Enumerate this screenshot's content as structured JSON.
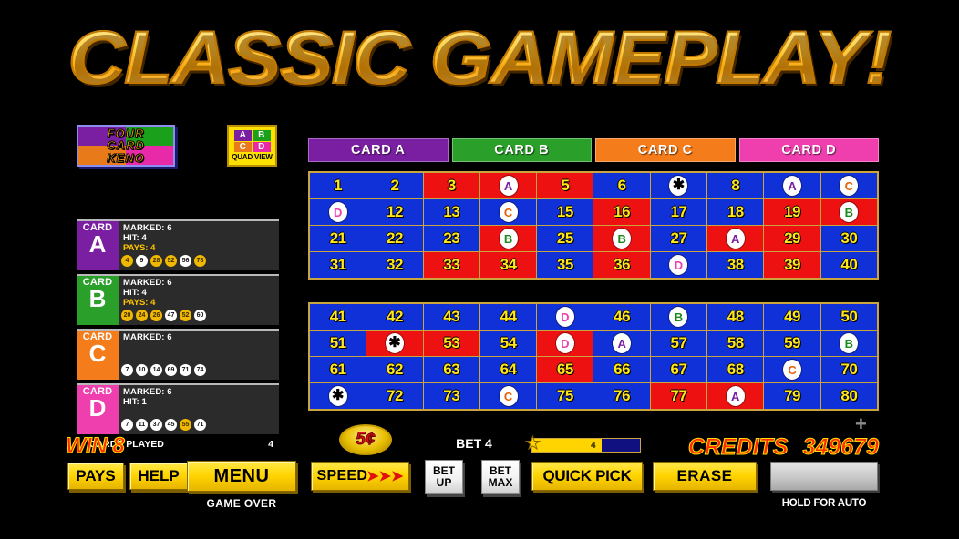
{
  "title": {
    "text": "CLASSIC GAMEPLAY!"
  },
  "logo": {
    "line1": "FOUR",
    "line2": "CARD",
    "line3": "KENO",
    "quad_view": {
      "label": "QUAD VIEW",
      "cells": [
        "A",
        "B",
        "C",
        "D"
      ]
    }
  },
  "cards": [
    {
      "word": "CARD",
      "letter": "A",
      "color": "#7a1fa2",
      "marked_label": "MARKED: 6",
      "hit_label": "HIT: 4",
      "pays_label": "PAYS: 4",
      "balls": [
        {
          "n": "4",
          "hit": true
        },
        {
          "n": "9",
          "hit": false
        },
        {
          "n": "28",
          "hit": true
        },
        {
          "n": "52",
          "hit": true
        },
        {
          "n": "56",
          "hit": false
        },
        {
          "n": "78",
          "hit": true
        }
      ]
    },
    {
      "word": "CARD",
      "letter": "B",
      "color": "#2aa02a",
      "marked_label": "MARKED: 6",
      "hit_label": "HIT: 4",
      "pays_label": "PAYS: 4",
      "balls": [
        {
          "n": "20",
          "hit": true
        },
        {
          "n": "24",
          "hit": true
        },
        {
          "n": "26",
          "hit": true
        },
        {
          "n": "47",
          "hit": false
        },
        {
          "n": "52",
          "hit": true
        },
        {
          "n": "60",
          "hit": false
        }
      ]
    },
    {
      "word": "CARD",
      "letter": "C",
      "color": "#f57c1a",
      "marked_label": "MARKED: 6",
      "hit_label": "",
      "pays_label": "",
      "balls": [
        {
          "n": "7",
          "hit": false
        },
        {
          "n": "10",
          "hit": false
        },
        {
          "n": "14",
          "hit": false
        },
        {
          "n": "69",
          "hit": false
        },
        {
          "n": "71",
          "hit": false
        },
        {
          "n": "74",
          "hit": false
        }
      ]
    },
    {
      "word": "CARD",
      "letter": "D",
      "color": "#ef3fae",
      "marked_label": "MARKED: 6",
      "hit_label": "HIT: 1",
      "pays_label": "",
      "balls": [
        {
          "n": "7",
          "hit": false
        },
        {
          "n": "11",
          "hit": false
        },
        {
          "n": "37",
          "hit": false
        },
        {
          "n": "45",
          "hit": false
        },
        {
          "n": "55",
          "hit": true
        },
        {
          "n": "71",
          "hit": false
        }
      ]
    }
  ],
  "cards_played": {
    "label": "CARDS PLAYED",
    "value": "4"
  },
  "card_tabs": [
    {
      "label": "CARD A"
    },
    {
      "label": "CARD B"
    },
    {
      "label": "CARD C"
    },
    {
      "label": "CARD D"
    }
  ],
  "keno": {
    "grid1": [
      {
        "n": "1",
        "bg": "blue",
        "mark": null
      },
      {
        "n": "2",
        "bg": "blue",
        "mark": null
      },
      {
        "n": "3",
        "bg": "red",
        "mark": null
      },
      {
        "n": "4",
        "bg": "red",
        "mark": "A"
      },
      {
        "n": "5",
        "bg": "red",
        "mark": null
      },
      {
        "n": "6",
        "bg": "blue",
        "mark": null
      },
      {
        "n": "7",
        "bg": "blue",
        "mark": "*"
      },
      {
        "n": "8",
        "bg": "blue",
        "mark": null
      },
      {
        "n": "9",
        "bg": "blue",
        "mark": "A"
      },
      {
        "n": "10",
        "bg": "blue",
        "mark": "C"
      },
      {
        "n": "11",
        "bg": "blue",
        "mark": "D"
      },
      {
        "n": "12",
        "bg": "blue",
        "mark": null
      },
      {
        "n": "13",
        "bg": "blue",
        "mark": null
      },
      {
        "n": "14",
        "bg": "blue",
        "mark": "C"
      },
      {
        "n": "15",
        "bg": "blue",
        "mark": null
      },
      {
        "n": "16",
        "bg": "red",
        "mark": null
      },
      {
        "n": "17",
        "bg": "blue",
        "mark": null
      },
      {
        "n": "18",
        "bg": "blue",
        "mark": null
      },
      {
        "n": "19",
        "bg": "red",
        "mark": null
      },
      {
        "n": "20",
        "bg": "red",
        "mark": "B"
      },
      {
        "n": "21",
        "bg": "blue",
        "mark": null
      },
      {
        "n": "22",
        "bg": "blue",
        "mark": null
      },
      {
        "n": "23",
        "bg": "blue",
        "mark": null
      },
      {
        "n": "24",
        "bg": "red",
        "mark": "B"
      },
      {
        "n": "25",
        "bg": "blue",
        "mark": null
      },
      {
        "n": "26",
        "bg": "red",
        "mark": "B"
      },
      {
        "n": "27",
        "bg": "blue",
        "mark": null
      },
      {
        "n": "28",
        "bg": "red",
        "mark": "A"
      },
      {
        "n": "29",
        "bg": "red",
        "mark": null
      },
      {
        "n": "30",
        "bg": "blue",
        "mark": null
      },
      {
        "n": "31",
        "bg": "blue",
        "mark": null
      },
      {
        "n": "32",
        "bg": "blue",
        "mark": null
      },
      {
        "n": "33",
        "bg": "red",
        "mark": null
      },
      {
        "n": "34",
        "bg": "red",
        "mark": null
      },
      {
        "n": "35",
        "bg": "blue",
        "mark": null
      },
      {
        "n": "36",
        "bg": "red",
        "mark": null
      },
      {
        "n": "37",
        "bg": "blue",
        "mark": "D"
      },
      {
        "n": "38",
        "bg": "blue",
        "mark": null
      },
      {
        "n": "39",
        "bg": "red",
        "mark": null
      },
      {
        "n": "40",
        "bg": "blue",
        "mark": null
      }
    ],
    "grid2": [
      {
        "n": "41",
        "bg": "blue",
        "mark": null
      },
      {
        "n": "42",
        "bg": "blue",
        "mark": null
      },
      {
        "n": "43",
        "bg": "blue",
        "mark": null
      },
      {
        "n": "44",
        "bg": "blue",
        "mark": null
      },
      {
        "n": "45",
        "bg": "blue",
        "mark": "D"
      },
      {
        "n": "46",
        "bg": "blue",
        "mark": null
      },
      {
        "n": "47",
        "bg": "blue",
        "mark": "B"
      },
      {
        "n": "48",
        "bg": "blue",
        "mark": null
      },
      {
        "n": "49",
        "bg": "blue",
        "mark": null
      },
      {
        "n": "50",
        "bg": "blue",
        "mark": null
      },
      {
        "n": "51",
        "bg": "blue",
        "mark": null
      },
      {
        "n": "52",
        "bg": "red",
        "mark": "*"
      },
      {
        "n": "53",
        "bg": "red",
        "mark": null
      },
      {
        "n": "54",
        "bg": "blue",
        "mark": null
      },
      {
        "n": "55",
        "bg": "red",
        "mark": "D"
      },
      {
        "n": "56",
        "bg": "blue",
        "mark": "A"
      },
      {
        "n": "57",
        "bg": "blue",
        "mark": null
      },
      {
        "n": "58",
        "bg": "blue",
        "mark": null
      },
      {
        "n": "59",
        "bg": "blue",
        "mark": null
      },
      {
        "n": "60",
        "bg": "blue",
        "mark": "B"
      },
      {
        "n": "61",
        "bg": "blue",
        "mark": null
      },
      {
        "n": "62",
        "bg": "blue",
        "mark": null
      },
      {
        "n": "63",
        "bg": "blue",
        "mark": null
      },
      {
        "n": "64",
        "bg": "blue",
        "mark": null
      },
      {
        "n": "65",
        "bg": "red",
        "mark": null
      },
      {
        "n": "66",
        "bg": "blue",
        "mark": null
      },
      {
        "n": "67",
        "bg": "blue",
        "mark": null
      },
      {
        "n": "68",
        "bg": "blue",
        "mark": null
      },
      {
        "n": "69",
        "bg": "blue",
        "mark": "C"
      },
      {
        "n": "70",
        "bg": "blue",
        "mark": null
      },
      {
        "n": "71",
        "bg": "blue",
        "mark": "*"
      },
      {
        "n": "72",
        "bg": "blue",
        "mark": null
      },
      {
        "n": "73",
        "bg": "blue",
        "mark": null
      },
      {
        "n": "74",
        "bg": "blue",
        "mark": "C"
      },
      {
        "n": "75",
        "bg": "blue",
        "mark": null
      },
      {
        "n": "76",
        "bg": "blue",
        "mark": null
      },
      {
        "n": "77",
        "bg": "red",
        "mark": null
      },
      {
        "n": "78",
        "bg": "red",
        "mark": "A"
      },
      {
        "n": "79",
        "bg": "blue",
        "mark": null
      },
      {
        "n": "80",
        "bg": "blue",
        "mark": null
      }
    ]
  },
  "footer": {
    "win_label": "WIN 8",
    "credits_label": "CREDITS",
    "credits_value": "349679",
    "pays_button": "PAYS",
    "help_button": "HELP",
    "menu_button": "MENU",
    "game_over": "GAME OVER",
    "denomination": "5¢",
    "speed_button": "SPEED",
    "speed_chevrons": "➤➤➤",
    "bet_label": "BET 4",
    "bet_up_line1": "BET",
    "bet_up_line2": "UP",
    "bet_max_line1": "BET",
    "bet_max_line2": "MAX",
    "bet_meter_value": "4",
    "quick_pick_button": "QUICK PICK",
    "erase_button": "ERASE",
    "hold_for_auto": "HOLD FOR AUTO",
    "plus_icon": "+"
  },
  "colors": {
    "card_a": "#7a1fa2",
    "card_b": "#2aa02a",
    "card_c": "#f57c1a",
    "card_d": "#ef3fae",
    "cell_blue": "#1030d8",
    "cell_red": "#ee1111",
    "number_yellow": "#ffe71a",
    "gold": "#ffd400",
    "credit_red": "#ff2a00"
  }
}
